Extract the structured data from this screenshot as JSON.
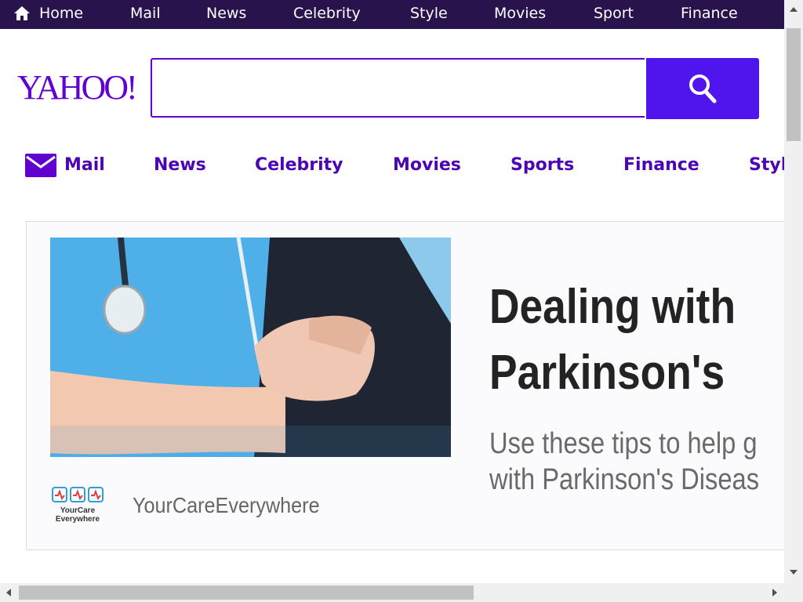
{
  "topnav": {
    "items": [
      {
        "label": "Home",
        "icon": "home-icon"
      },
      {
        "label": "Mail"
      },
      {
        "label": "News"
      },
      {
        "label": "Celebrity"
      },
      {
        "label": "Style"
      },
      {
        "label": "Movies"
      },
      {
        "label": "Sport"
      },
      {
        "label": "Finance"
      }
    ]
  },
  "header": {
    "logo_text": "YAHOO!",
    "search": {
      "value": "",
      "placeholder": "",
      "button_icon": "search-icon"
    }
  },
  "subnav": {
    "items": [
      {
        "label": "Mail",
        "icon": "mail-icon"
      },
      {
        "label": "News"
      },
      {
        "label": "Celebrity"
      },
      {
        "label": "Movies"
      },
      {
        "label": "Sports"
      },
      {
        "label": "Finance"
      },
      {
        "label": "Styl"
      }
    ]
  },
  "card": {
    "headline_line1": "Dealing with",
    "headline_line2": "Parkinson's",
    "summary_line1": "Use these tips to help g",
    "summary_line2": "with Parkinson's Diseas",
    "source_name": "YourCareEverywhere",
    "source_logo_text_1": "YourCare",
    "source_logo_text_2": "Everywhere"
  },
  "colors": {
    "topbar": "#29134d",
    "brand": "#6001d2",
    "search_button": "#5015ec",
    "subnav_text": "#4b05b4"
  }
}
